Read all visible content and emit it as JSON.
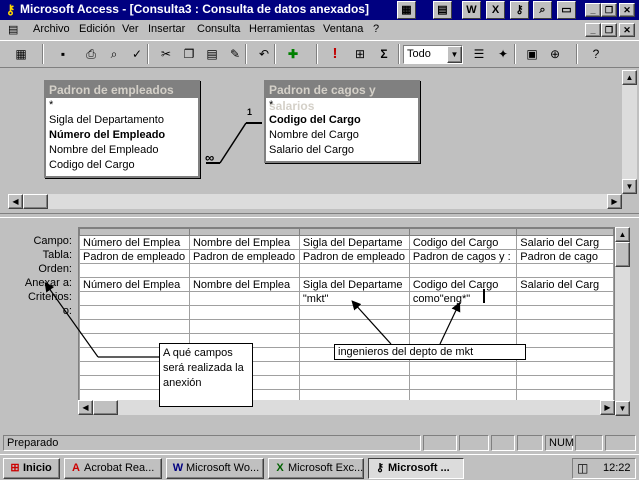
{
  "window": {
    "title": "Microsoft Access - [Consulta3 : Consulta de datos anexados]",
    "app_icon": "access-key-icon",
    "title_icons": [
      "toolbar-window-icon",
      "notepad-icon",
      "word-icon",
      "excel-icon",
      "key-icon",
      "search-icon",
      "monitor-icon"
    ],
    "title_icon_glyphs": [
      "▦",
      "▤",
      "W",
      "X",
      "⚷",
      "⌕",
      "▭"
    ],
    "controls": {
      "minimize": "_",
      "restore": "❐",
      "close": "✕"
    }
  },
  "menu": {
    "items": [
      {
        "label": "Archivo"
      },
      {
        "label": "Edición"
      },
      {
        "label": "Ver"
      },
      {
        "label": "Insertar"
      },
      {
        "label": "Consulta"
      },
      {
        "label": "Herramientas"
      },
      {
        "label": "Ventana"
      },
      {
        "label": "?"
      }
    ]
  },
  "toolbar": {
    "buttons": [
      {
        "name": "view-icon",
        "glyph": "▦"
      },
      {
        "name": "save-icon",
        "glyph": "▪"
      },
      {
        "name": "print-icon",
        "glyph": "⎙"
      },
      {
        "name": "print-preview-icon",
        "glyph": "⌕"
      },
      {
        "name": "spelling-icon",
        "glyph": "✓"
      },
      {
        "name": "cut-icon",
        "glyph": "✂"
      },
      {
        "name": "copy-icon",
        "glyph": "❐"
      },
      {
        "name": "paste-icon",
        "glyph": "▤"
      },
      {
        "name": "format-painter-icon",
        "glyph": "✎"
      },
      {
        "name": "undo-icon",
        "glyph": "↶"
      },
      {
        "name": "query-type-icon",
        "glyph": "✚"
      },
      {
        "name": "run-icon",
        "glyph": "!"
      },
      {
        "name": "show-table-icon",
        "glyph": "⊞"
      },
      {
        "name": "totals-icon",
        "glyph": "Σ"
      },
      {
        "name": "properties-icon",
        "glyph": "☰"
      },
      {
        "name": "build-icon",
        "glyph": "✦"
      },
      {
        "name": "database-window-icon",
        "glyph": "▣"
      },
      {
        "name": "new-object-icon",
        "glyph": "⊕"
      },
      {
        "name": "help-icon",
        "glyph": "?"
      }
    ],
    "top_values": "Todo"
  },
  "tables": [
    {
      "title": "Padron de empleados",
      "fields": [
        {
          "label": "*",
          "bold": false
        },
        {
          "label": "Sigla del Departamento",
          "bold": false
        },
        {
          "label": "Número del Empleado",
          "bold": true
        },
        {
          "label": "Nombre del Empleado",
          "bold": false
        },
        {
          "label": "Codigo del Cargo",
          "bold": false
        }
      ]
    },
    {
      "title": "Padron de cagos y salarios",
      "fields": [
        {
          "label": "*",
          "bold": false
        },
        {
          "label": "Codigo del Cargo",
          "bold": true
        },
        {
          "label": "Nombre del Cargo",
          "bold": false
        },
        {
          "label": "Salario del Cargo",
          "bold": false
        }
      ]
    }
  ],
  "relationship": {
    "one_label": "1",
    "many_label": "∞"
  },
  "grid": {
    "row_labels": [
      "Campo:",
      "Tabla:",
      "Orden:",
      "Anexar a:",
      "Criterios:",
      "o:"
    ],
    "columns": [
      {
        "campo": "Número del Emplea",
        "tabla": "Padron de empleado",
        "orden": "",
        "anexar": "Número del Emplea",
        "criterios": ""
      },
      {
        "campo": "Nombre del Emplea",
        "tabla": "Padron de empleado",
        "orden": "",
        "anexar": "Nombre del Emplea",
        "criterios": ""
      },
      {
        "campo": "Sigla del Departame",
        "tabla": "Padron de empleado",
        "orden": "",
        "anexar": "Sigla del Departame",
        "criterios": "\"mkt\""
      },
      {
        "campo": "Codigo del Cargo",
        "tabla": "Padron de cagos y :",
        "orden": "",
        "anexar": "Codigo del Cargo",
        "criterios": "como\"eng*\""
      },
      {
        "campo": "Salario del Carg",
        "tabla": "Padron de cago",
        "orden": "",
        "anexar": "Salario del Carg",
        "criterios": ""
      }
    ]
  },
  "annotations": {
    "fields": "A qué campos será realizada la anexión",
    "criteria": "ingenieros del depto de mkt"
  },
  "status": {
    "text": "Preparado",
    "num": "NUM"
  },
  "taskbar": {
    "start": "Inicio",
    "tasks": [
      {
        "label": "Acrobat Rea...",
        "icon": "acrobat-icon",
        "glyph": "A",
        "active": false
      },
      {
        "label": "Microsoft Wo...",
        "icon": "word-icon",
        "glyph": "W",
        "active": false
      },
      {
        "label": "Microsoft Exc...",
        "icon": "excel-icon",
        "glyph": "X",
        "active": false
      },
      {
        "label": "Microsoft ...",
        "icon": "access-icon",
        "glyph": "⚷",
        "active": true
      }
    ],
    "clock": "12:22"
  },
  "colors": {
    "title_bar": "#000080",
    "face": "#c0c0c0",
    "table_title": "#808080"
  }
}
